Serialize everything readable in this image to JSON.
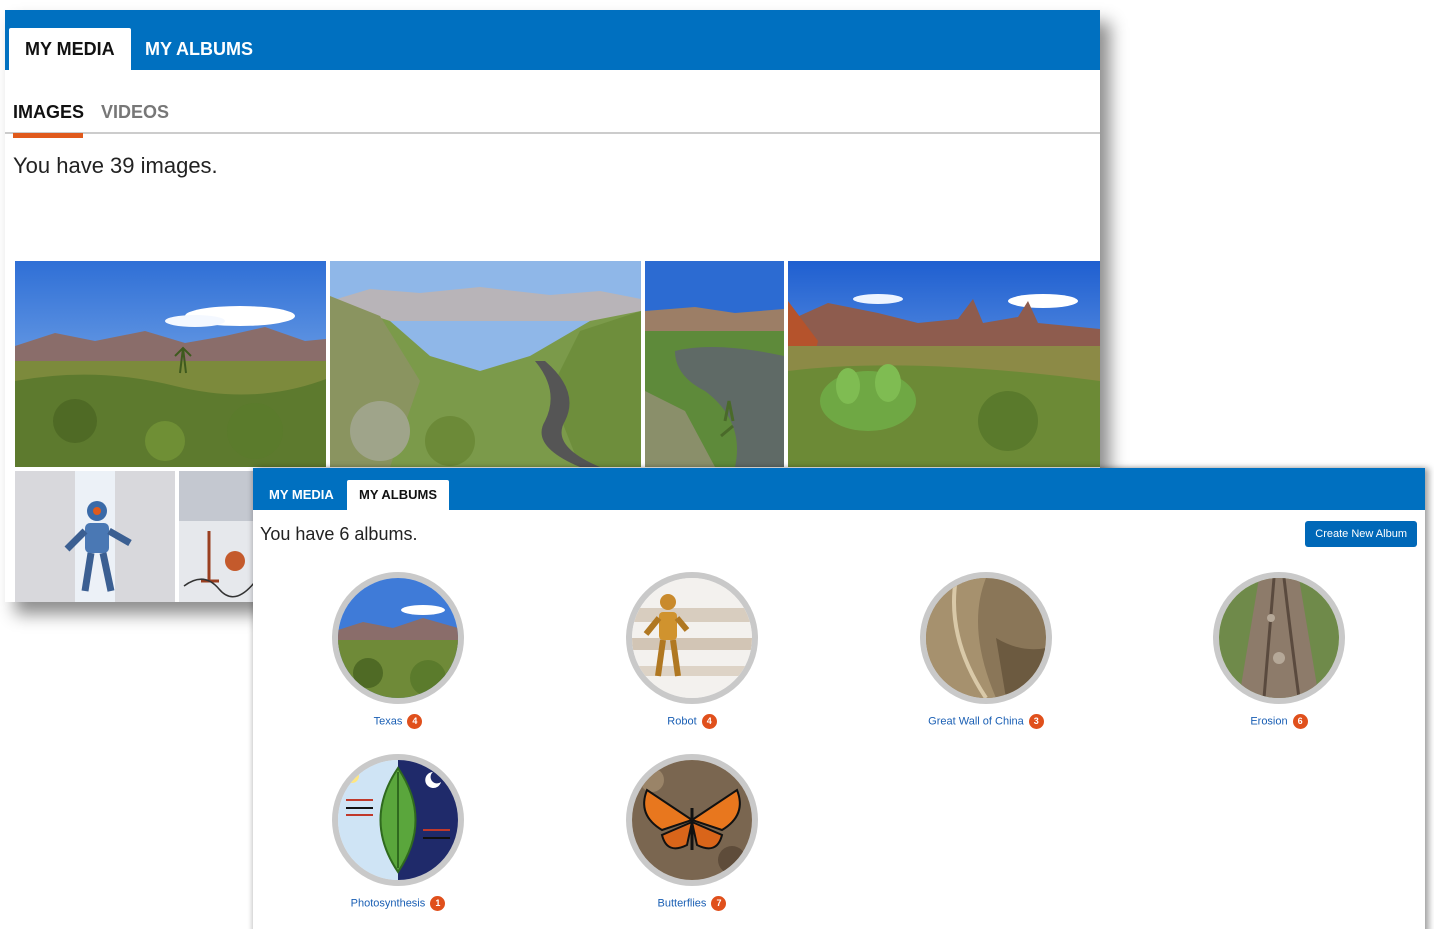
{
  "media_window": {
    "tabs": [
      {
        "label": "MY MEDIA",
        "active": true
      },
      {
        "label": "MY ALBUMS",
        "active": false
      }
    ],
    "subtabs": [
      {
        "label": "IMAGES",
        "active": true
      },
      {
        "label": "VIDEOS",
        "active": false
      }
    ],
    "count_text": "You have 39 images.",
    "thumbnails_row1": [
      "desert-plain",
      "canyon-road",
      "river-gorge",
      "cactus-peaks"
    ],
    "thumbnails_row2": [
      "robot-figure",
      "robot-studio"
    ]
  },
  "albums_window": {
    "tabs": [
      {
        "label": "MY MEDIA",
        "active": false
      },
      {
        "label": "MY ALBUMS",
        "active": true
      }
    ],
    "count_text": "You have 6 albums.",
    "create_button": "Create New Album",
    "albums": [
      {
        "name": "Texas",
        "count": "4"
      },
      {
        "name": "Robot",
        "count": "4"
      },
      {
        "name": "Great Wall of China",
        "count": "3"
      },
      {
        "name": "Erosion",
        "count": "6"
      },
      {
        "name": "Photosynthesis",
        "count": "1"
      },
      {
        "name": "Butterflies",
        "count": "7"
      }
    ]
  },
  "colors": {
    "header_blue": "#0070c0",
    "accent_orange": "#e05a1c",
    "link_blue": "#1a5fb4",
    "badge_orange": "#e0501c"
  }
}
